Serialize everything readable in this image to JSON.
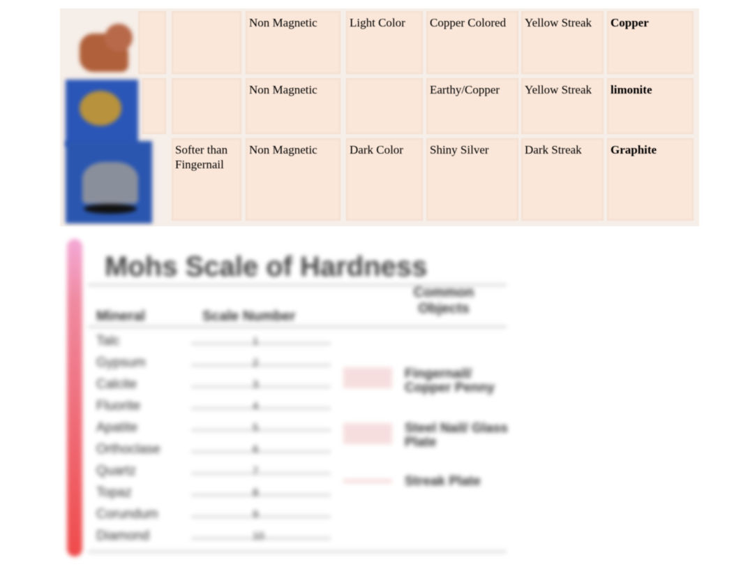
{
  "mineral_table": {
    "rows": [
      {
        "image": "copper-sample-image",
        "hardness": "",
        "magnetism": "Non Magnetic",
        "color_shade": "Light Color",
        "luster": "Copper Colored",
        "streak": "Yellow Streak",
        "mineral": "Copper"
      },
      {
        "image": "limonite-sample-image",
        "hardness": "",
        "magnetism": "Non Magnetic",
        "color_shade": "",
        "luster": "Earthy/Copper",
        "streak": "Yellow Streak",
        "mineral": "limonite"
      },
      {
        "image": "graphite-sample-image",
        "hardness": "Softer than Fingernail",
        "magnetism": "Non Magnetic",
        "color_shade": "Dark Color",
        "luster": "Shiny Silver",
        "streak": "Dark Streak",
        "mineral": "Graphite"
      }
    ]
  },
  "mohs_chart": {
    "title": "Mohs Scale of Hardness",
    "headers": [
      "Mineral",
      "Scale Number",
      "Common Objects"
    ],
    "minerals": [
      "Talc",
      "Gypsum",
      "Calcite",
      "Fluorite",
      "Apatite",
      "Orthoclase",
      "Quartz",
      "Topaz",
      "Corundum",
      "Diamond"
    ],
    "numbers": [
      "1",
      "2",
      "3",
      "4",
      "5",
      "6",
      "7",
      "8",
      "9",
      "10"
    ],
    "objects": [
      "Fingernail/ Copper Penny",
      "Steel Nail/ Glass Plate",
      "Streak Plate"
    ],
    "gradient_colors": [
      "#f4a9d6",
      "#ef4b4b"
    ]
  }
}
